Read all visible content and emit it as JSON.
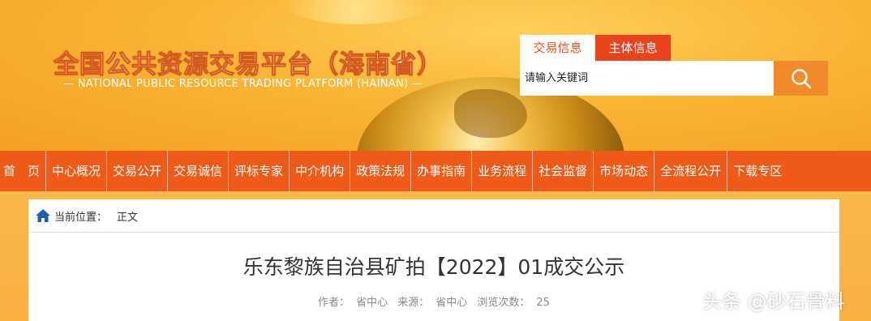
{
  "header": {
    "title": "全国公共资源交易平台（海南省）",
    "subtitle": "— NATIONAL PUBLIC RESOURCE TRADING PLATFORM (HAINAN) —"
  },
  "search": {
    "tabs": [
      "交易信息",
      "主体信息"
    ],
    "active_tab": 0,
    "placeholder": "请输入关键词",
    "button_icon": "search-icon"
  },
  "nav": {
    "items": [
      "首　页",
      "中心概况",
      "交易公开",
      "交易诚信",
      "评标专家",
      "中介机构",
      "政策法规",
      "办事指南",
      "业务流程",
      "社会监督",
      "市场动态",
      "全流程公开",
      "下载专区"
    ]
  },
  "breadcrumb": {
    "icon": "home-icon",
    "label": "当前位置：",
    "current": "正文"
  },
  "article": {
    "title": "乐东黎族自治县矿拍【2022】01成交公示",
    "author_label": "作者：",
    "author": "省中心",
    "source_label": "来源：",
    "source": "省中心",
    "views_label": "浏览次数：",
    "views": "25"
  },
  "watermark": "头条 @砂石骨料",
  "colors": {
    "accent_orange": "#ee5a17",
    "tab_red": "#e8431a",
    "search_button": "#f08a2a",
    "header_gold": "#f9b534"
  }
}
